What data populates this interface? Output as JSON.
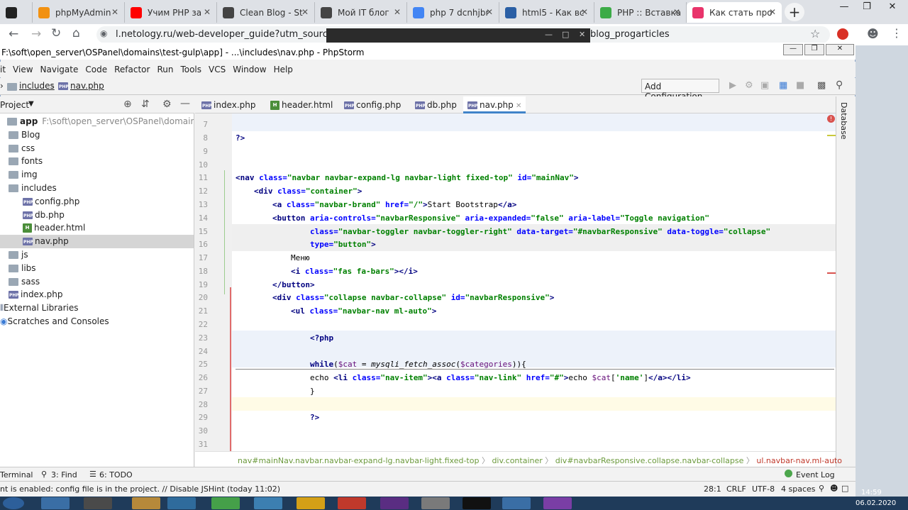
{
  "browser": {
    "tabs": [
      {
        "title": "",
        "color": "#222222"
      },
      {
        "title": "phpMyAdmin",
        "color": "#f29111"
      },
      {
        "title": "Учим PHP за",
        "color": "#ff0000"
      },
      {
        "title": "Clean Blog - St",
        "color": "#444444"
      },
      {
        "title": "Мой IT блог",
        "color": "#444444"
      },
      {
        "title": "php 7 dcnhjbr",
        "color": "#4285f4"
      },
      {
        "title": "html5 - Как вс",
        "color": "#2a5fa5"
      },
      {
        "title": "PHP :: Вставка",
        "color": "#3cab47"
      },
      {
        "title": "Как стать про",
        "color": "#e9346b"
      }
    ],
    "new_tab": "+",
    "url": "l.netology.ru/web-developer_guide?utm_source=bl",
    "url_tail": "blog_progarticles"
  },
  "ide": {
    "title": "F:\\soft\\open_server\\OSPanel\\domains\\test-gulp\\app] - ...\\includes\\nav.php - PhpStorm",
    "menu": [
      "it",
      "View",
      "Navigate",
      "Code",
      "Refactor",
      "Run",
      "Tools",
      "VCS",
      "Window",
      "Help"
    ],
    "breadcrumb": {
      "folder": "includes",
      "file": "nav.php"
    },
    "add_configuration": "Add Configuration...",
    "project_label": "Project",
    "tree": [
      {
        "label": "app",
        "note": "F:\\soft\\open_server\\OSPanel\\domains\\test-gulp",
        "kind": "folder",
        "indent": 0
      },
      {
        "label": "Blog",
        "kind": "folder",
        "indent": 1
      },
      {
        "label": "css",
        "kind": "folder",
        "indent": 1
      },
      {
        "label": "fonts",
        "kind": "folder",
        "indent": 1
      },
      {
        "label": "img",
        "kind": "folder",
        "indent": 1
      },
      {
        "label": "includes",
        "kind": "folder",
        "indent": 1
      },
      {
        "label": "config.php",
        "kind": "php",
        "indent": 2
      },
      {
        "label": "db.php",
        "kind": "php",
        "indent": 2
      },
      {
        "label": "header.html",
        "kind": "html",
        "indent": 2
      },
      {
        "label": "nav.php",
        "kind": "php",
        "indent": 2,
        "selected": true
      },
      {
        "label": "js",
        "kind": "folder",
        "indent": 1
      },
      {
        "label": "libs",
        "kind": "folder",
        "indent": 1
      },
      {
        "label": "sass",
        "kind": "folder",
        "indent": 1
      },
      {
        "label": "index.php",
        "kind": "php",
        "indent": 1
      },
      {
        "label": "External Libraries",
        "kind": "lib",
        "indent": 0
      },
      {
        "label": "Scratches and Consoles",
        "kind": "scratch",
        "indent": 0
      }
    ],
    "editor_tabs": [
      {
        "label": "index.php",
        "kind": "php"
      },
      {
        "label": "header.html",
        "kind": "html"
      },
      {
        "label": "config.php",
        "kind": "php"
      },
      {
        "label": "db.php",
        "kind": "php"
      },
      {
        "label": "nav.php",
        "kind": "php",
        "active": true
      }
    ],
    "line_numbers": [
      "7",
      "8",
      "9",
      "10",
      "11",
      "12",
      "13",
      "14",
      "15",
      "16",
      "17",
      "18",
      "19",
      "20",
      "21",
      "22",
      "23",
      "24",
      "25",
      "26",
      "27",
      "28",
      "29",
      "30",
      "31"
    ],
    "code_plain": {
      "l8": "?>",
      "l17": "Меню",
      "l23": "<?php",
      "l27": "}",
      "l29": "?>"
    },
    "right_tool": "Database",
    "code_breadcrumb": [
      "nav#mainNav.navbar.navbar-expand-lg.navbar-light.fixed-top",
      "div.container",
      "div#navbarResponsive.collapse.navbar-collapse",
      "ul.navbar-nav.ml-auto"
    ],
    "bottom_tabs": [
      "Terminal",
      "3: Find",
      "6: TODO"
    ],
    "event_log": "Event Log",
    "status_message": "nt is enabled: config file is in the project. // Disable JSHint (today 11:02)",
    "status_right": [
      "28:1",
      "CRLF",
      "UTF-8",
      "4 spaces"
    ]
  },
  "taskbar": {
    "time": "14:59",
    "date": "06.02.2020"
  }
}
